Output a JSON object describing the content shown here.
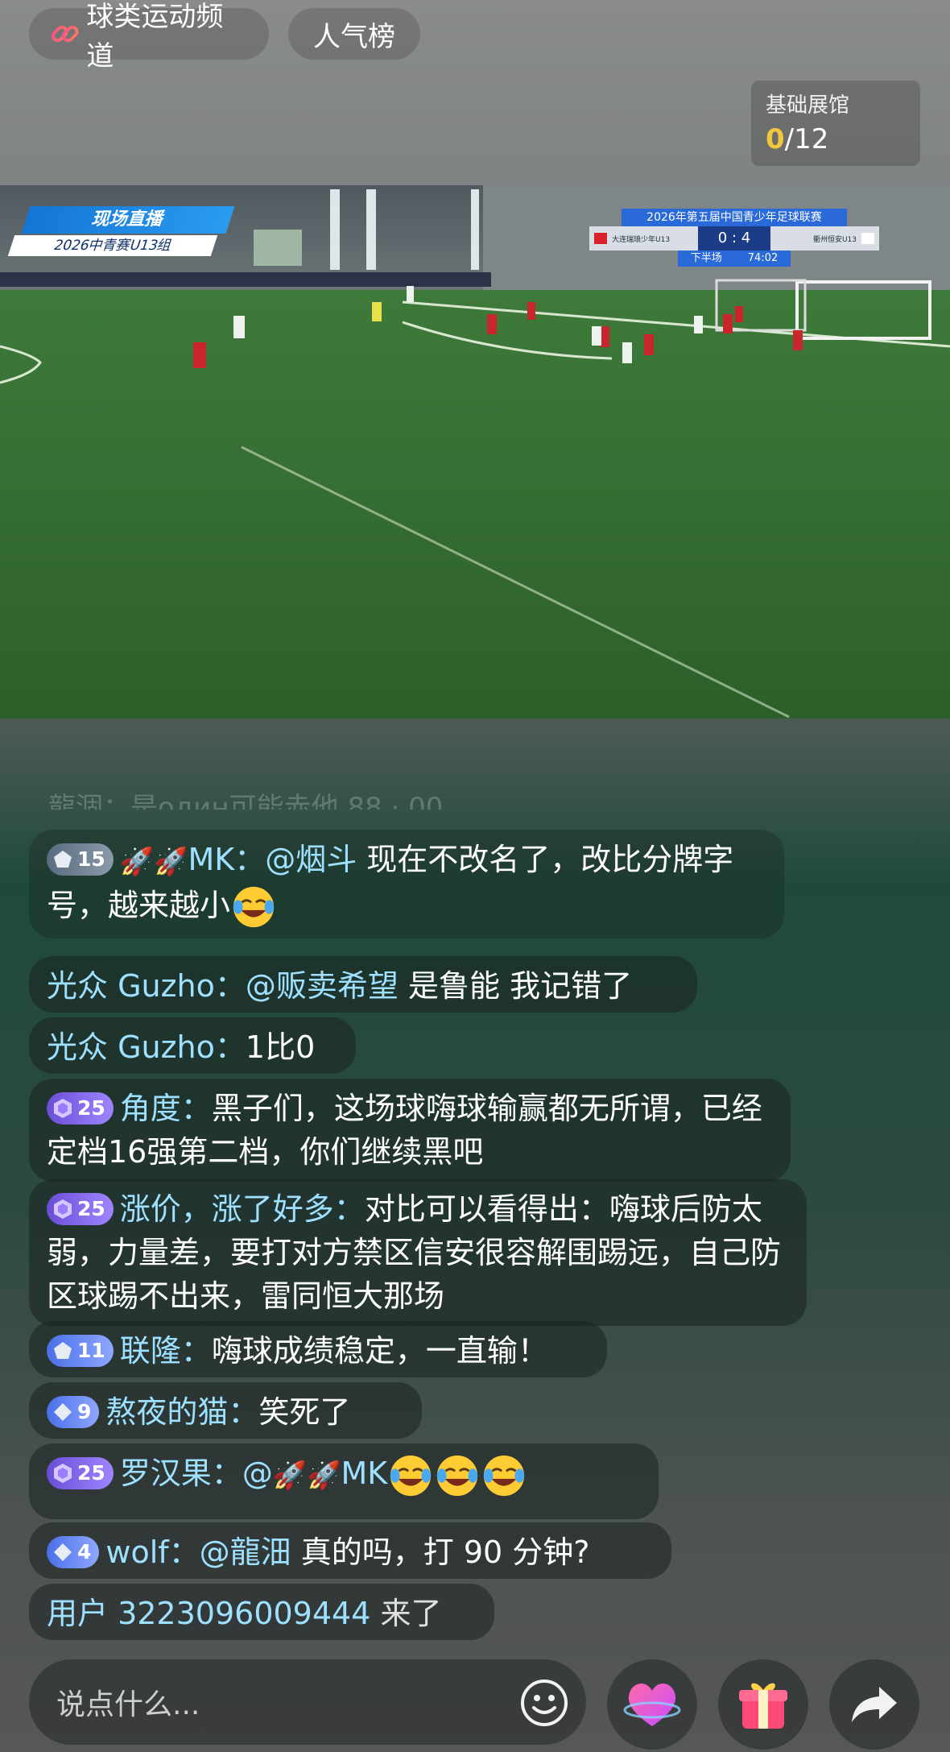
{
  "top_bar": {
    "channel_label": "球类运动频道",
    "popular_label": "人气榜"
  },
  "expo": {
    "title": "基础展馆",
    "current": "0",
    "total": "/12"
  },
  "video": {
    "live_label": "现场直播",
    "group_label": "2026中青赛U13组",
    "league_title": "2026年第五届中国青少年足球联赛",
    "home_team": "大连瑞琅少年U13",
    "away_team": "衢州恒安U13",
    "score": "0 : 4",
    "period": "下半场",
    "clock": "74:02"
  },
  "chat": {
    "faded_top": "龍涸：是один可能赤他 88 · 00",
    "messages": [
      {
        "badge": "15",
        "badge_color": "blue",
        "user": "MK：",
        "at": "@烟斗",
        "text": " 现在不改名了，改比分牌字号，越来越小"
      },
      {
        "user": "光众 Guzho：",
        "at": "@贩卖希望",
        "text": " 是鲁能 我记错了"
      },
      {
        "user": "光众 Guzho：",
        "text": "1比0"
      },
      {
        "badge": "25",
        "badge_color": "purple",
        "user": "角度：",
        "text": "黑子们，这场球嗨球输赢都无所谓，已经定档16强第二档，你们继续黑吧"
      },
      {
        "badge": "25",
        "badge_color": "purple",
        "user": "涨价，涨了好多：",
        "text": "对比可以看得出：嗨球后防太弱，力量差，要打对方禁区信安很容解围踢远，自己防区球踢不出来，雷同恒大那场"
      },
      {
        "badge": "11",
        "badge_color": "blue",
        "user": "联隆：",
        "text": "嗨球成绩稳定，一直输！"
      },
      {
        "badge": "9",
        "badge_color": "blue",
        "user": "熬夜的猫：",
        "text": "笑死了"
      },
      {
        "badge": "25",
        "badge_color": "purple",
        "user": "罗汉果：",
        "at": "@",
        "text": "MK"
      },
      {
        "badge": "4",
        "badge_color": "blue",
        "user": "wolf：",
        "at": "@龍沺",
        "text": " 真的吗，打 90 分钟?"
      },
      {
        "user": "用户 3223096009444",
        "text": " 来了"
      }
    ]
  },
  "input": {
    "placeholder": "说点什么..."
  },
  "icons": {
    "link": "link-icon",
    "smiley": "smiley-icon",
    "heart": "heart-icon",
    "gift": "gift-icon",
    "share": "share-icon"
  },
  "colors": {
    "name_color": "#9ee0ff",
    "expo_current": "#f4c63a",
    "badge_purple": "#7a5fe0",
    "badge_blue": "#5a7cf0"
  }
}
